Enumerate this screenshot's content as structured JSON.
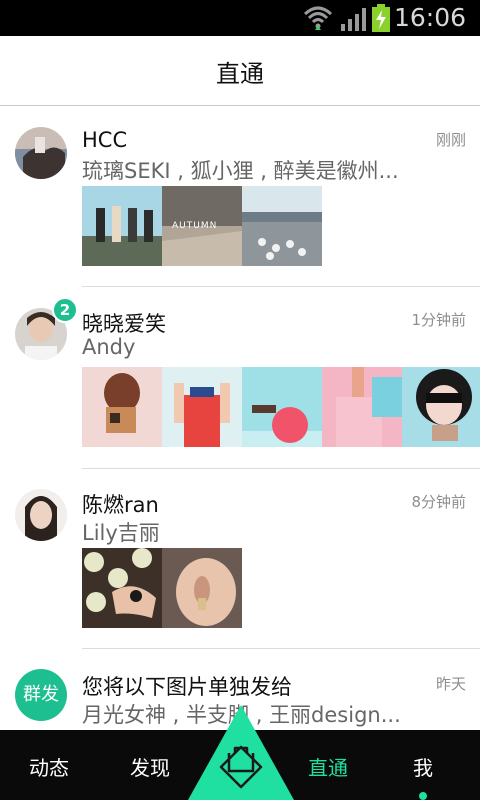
{
  "status_bar": {
    "time": "16:06"
  },
  "header": {
    "title": "直通"
  },
  "feed": [
    {
      "name": "HCC",
      "time": "刚刚",
      "subtitle": "琉璃SEKI , 狐小狸 , 醉美是徽州...",
      "avatar": "avatar-hcc",
      "badge": ""
    },
    {
      "name": "晓晓爱笑",
      "time": "1分钟前",
      "subtitle": "Andy",
      "avatar": "avatar-xiaoxiao",
      "badge": "2"
    },
    {
      "name": "陈燃ran",
      "time": "8分钟前",
      "subtitle": "Lily吉丽",
      "avatar": "avatar-chenran",
      "badge": ""
    },
    {
      "name": "您将以下图片单独发给",
      "time": "昨天",
      "subtitle": "月光女神 , 半支脚 , 王丽design...",
      "avatar_text": "群发",
      "badge": ""
    }
  ],
  "bottom_nav": {
    "items": [
      {
        "label": "动态"
      },
      {
        "label": "发现"
      },
      {
        "label": "直通"
      },
      {
        "label": "我"
      }
    ],
    "active": "直通"
  },
  "colors": {
    "accent": "#1fe0a0",
    "badge": "#1dbf91"
  }
}
